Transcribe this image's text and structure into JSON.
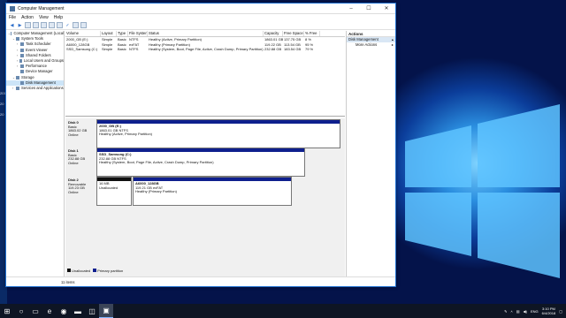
{
  "window": {
    "title": "Computer Management",
    "controls": [
      "–",
      "☐",
      "✕"
    ]
  },
  "menu": [
    "File",
    "Action",
    "View",
    "Help"
  ],
  "tree": [
    {
      "label": "Computer Management (Local",
      "indent": 0,
      "exp": "⌄",
      "sel": false
    },
    {
      "label": "System Tools",
      "indent": 1,
      "exp": "⌄",
      "sel": false
    },
    {
      "label": "Task Scheduler",
      "indent": 2,
      "exp": "›",
      "sel": false
    },
    {
      "label": "Event Viewer",
      "indent": 2,
      "exp": "›",
      "sel": false
    },
    {
      "label": "Shared Folders",
      "indent": 2,
      "exp": "›",
      "sel": false
    },
    {
      "label": "Local Users and Groups",
      "indent": 2,
      "exp": "›",
      "sel": false
    },
    {
      "label": "Performance",
      "indent": 2,
      "exp": "›",
      "sel": false
    },
    {
      "label": "Device Manager",
      "indent": 2,
      "exp": "",
      "sel": false
    },
    {
      "label": "Storage",
      "indent": 1,
      "exp": "⌄",
      "sel": false
    },
    {
      "label": "Disk Management",
      "indent": 2,
      "exp": "",
      "sel": true
    },
    {
      "label": "Services and Applications",
      "indent": 1,
      "exp": "›",
      "sel": false
    }
  ],
  "volumes": {
    "headers": [
      "Volume",
      "Layout",
      "Type",
      "File System",
      "Status",
      "Capacity",
      "Free Space",
      "% Free"
    ],
    "rows": [
      [
        "2000_GB (E:)",
        "Simple",
        "Basic",
        "NTFS",
        "Healthy (Active, Primary Partition)",
        "1863.01 GB",
        "137.75 GB",
        "8 %"
      ],
      [
        "A6000_128GB",
        "Simple",
        "Basic",
        "exFAT",
        "Healthy (Primary Partition)",
        "119.22 GB",
        "113.54 GB",
        "95 %"
      ],
      [
        "SSD_Samsung (C:)",
        "Simple",
        "Basic",
        "NTFS",
        "Healthy (System, Boot, Page File, Active, Crash Dump, Primary Partition)",
        "232.88 GB",
        "183.54 GB",
        "79 %"
      ]
    ]
  },
  "disks": [
    {
      "name": "Disk 0",
      "type": "Basic",
      "size": "1863.02 GB",
      "state": "Online",
      "parts": [
        {
          "title": "2000_GB (E:)",
          "line1": "1863.01 GB NTFS",
          "line2": "Healthy (Active, Primary Partition)",
          "bar": "blue"
        }
      ]
    },
    {
      "name": "Disk 1",
      "type": "Basic",
      "size": "232.88 GB",
      "state": "Online",
      "parts": [
        {
          "title": "SSD_Samsung (C:)",
          "line1": "232.88 GB NTFS",
          "line2": "Healthy (System, Boot, Page File, Active, Crash Dump, Primary Partition)",
          "bar": "blue"
        }
      ]
    },
    {
      "name": "Disk 2",
      "type": "Removable",
      "size": "119.23 GB",
      "state": "Online",
      "parts": [
        {
          "title": "",
          "line1": "16 MB",
          "line2": "Unallocated",
          "bar": "black"
        },
        {
          "title": "A6000_128GB",
          "line1": "119.21 GB exFAT",
          "line2": "Healthy (Primary Partition)",
          "bar": "blue"
        }
      ]
    }
  ],
  "legend": [
    {
      "label": "Unallocated",
      "color": "#111111"
    },
    {
      "label": "Primary partition",
      "color": "#0e1f8e"
    }
  ],
  "actions": {
    "header": "Actions",
    "section": "Disk Management",
    "more": "More Actions"
  },
  "status": "11 items",
  "taskbar": {
    "time": "3:10 PM",
    "date": "6/4/2018",
    "lang": "ENG"
  },
  "desktop_side": [
    "201",
    "20",
    "20"
  ],
  "colors": {
    "accent": "#0e1f8e",
    "selection": "#cce4f7",
    "desktop": "#0b3d9a"
  }
}
